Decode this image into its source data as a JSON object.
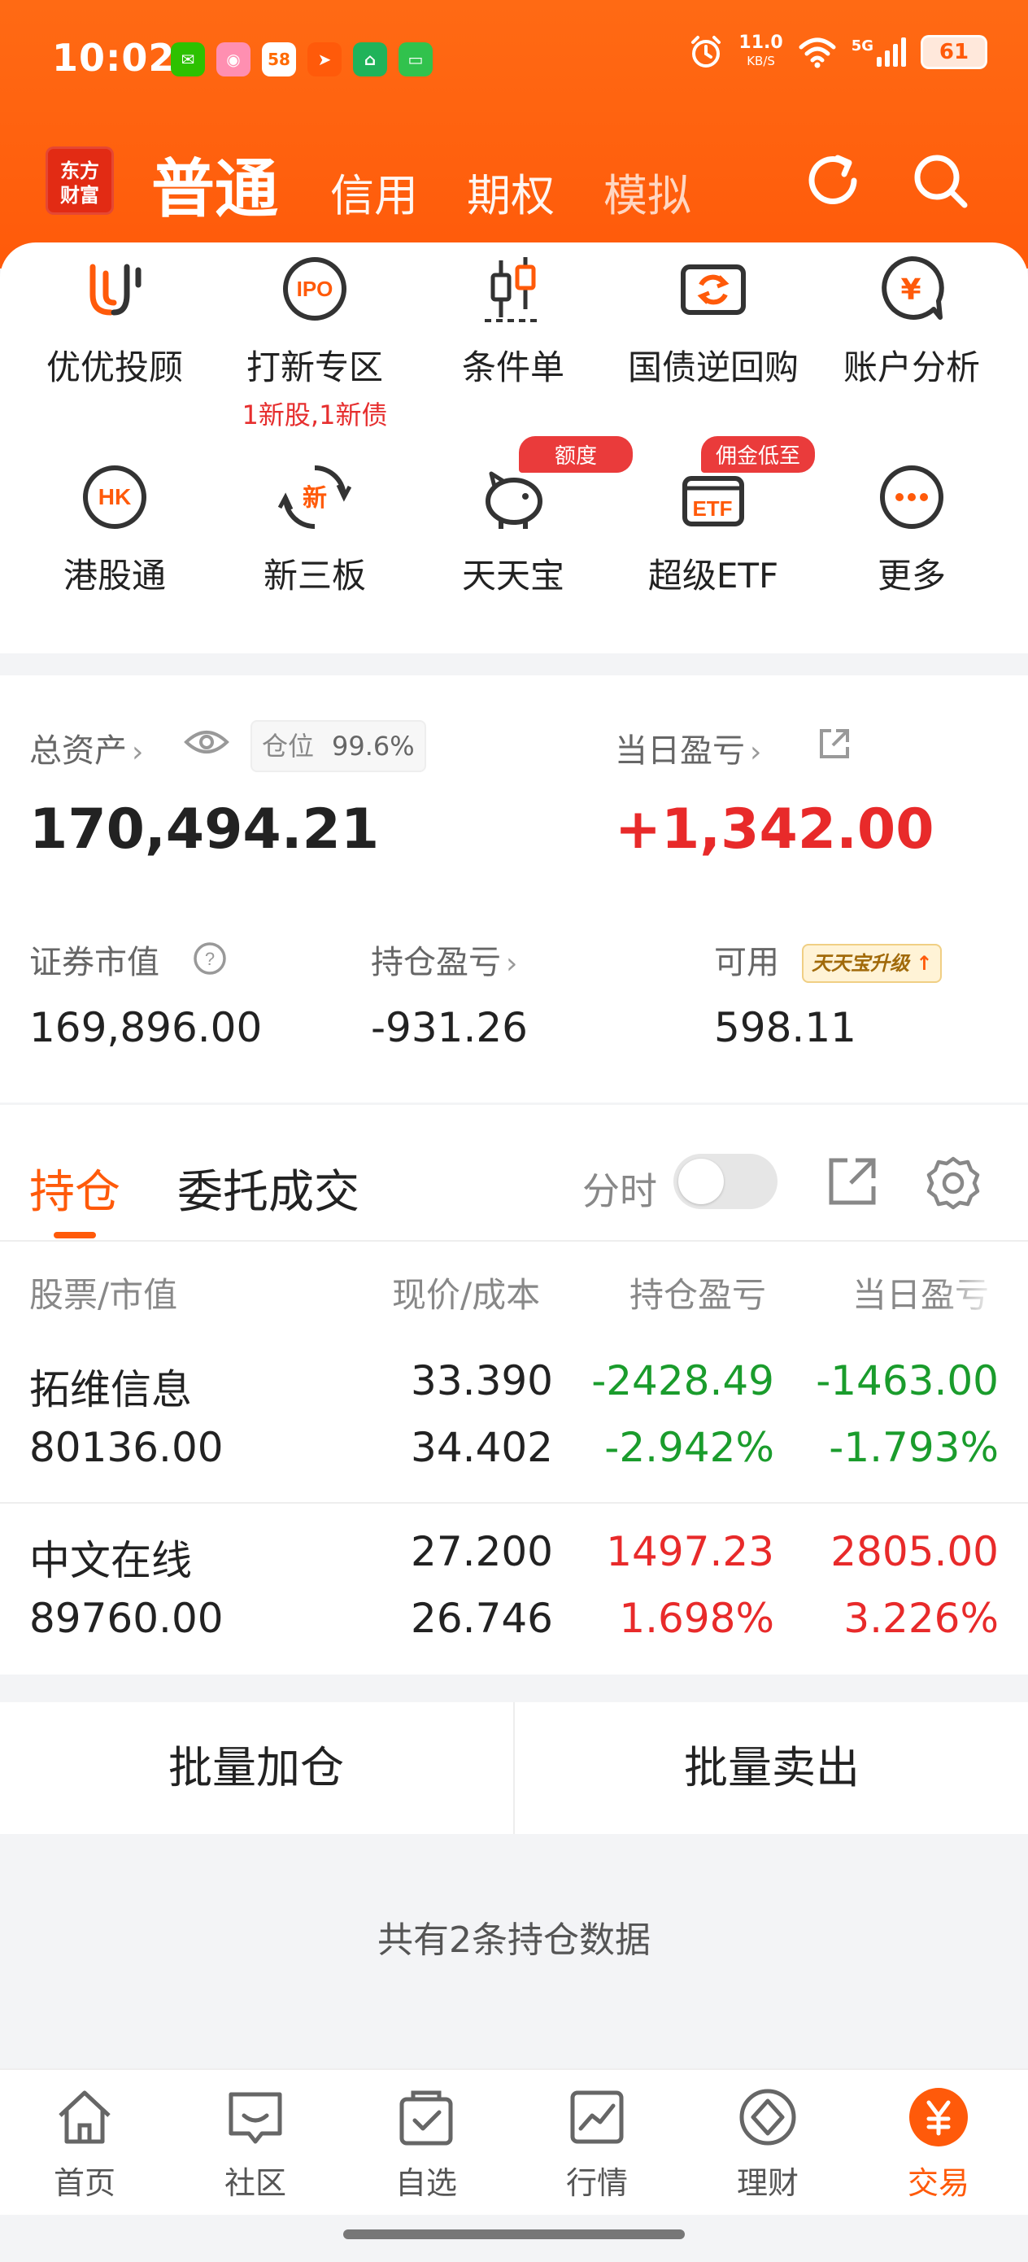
{
  "status_bar": {
    "time": "10:02",
    "net_speed": "11.0",
    "net_unit": "KB/S",
    "network": "5G",
    "battery": "61"
  },
  "notif_icons": [
    "wechat-icon",
    "bilibili-icon",
    "app58-icon",
    "paper-plane-icon",
    "home-app-icon",
    "message-icon"
  ],
  "header": {
    "logo_line1": "东方",
    "logo_line2": "财富",
    "tabs": [
      "普通",
      "信用",
      "期权",
      "模拟"
    ],
    "active_tab": "普通"
  },
  "features": [
    {
      "label": "优优投顾",
      "icon": "uu-advisor-icon"
    },
    {
      "label": "打新专区",
      "sub": "1新股,1新债",
      "icon": "ipo-icon"
    },
    {
      "label": "条件单",
      "icon": "candlestick-icon"
    },
    {
      "label": "国债逆回购",
      "icon": "bond-repo-icon"
    },
    {
      "label": "账户分析",
      "icon": "yen-chat-icon"
    },
    {
      "label": "港股通",
      "icon": "hk-icon"
    },
    {
      "label": "新三板",
      "icon": "new-board-icon"
    },
    {
      "label": "天天宝",
      "badge": "额度",
      "icon": "piggy-bank-icon"
    },
    {
      "label": "超级ETF",
      "badge": "佣金低至",
      "icon": "etf-icon"
    },
    {
      "label": "更多",
      "icon": "more-icon"
    }
  ],
  "assets": {
    "total_label": "总资产",
    "position_label": "仓位",
    "position_value": "99.6%",
    "total_value": "170,494.21",
    "daily_label": "当日盈亏",
    "daily_value": "+1,342.00",
    "market_value_label": "证券市值",
    "market_value": "169,896.00",
    "holding_pl_label": "持仓盈亏",
    "holding_pl": "-931.26",
    "available_label": "可用",
    "available_value": "598.11",
    "tiantianbao_chip": "天天宝升级"
  },
  "holdings": {
    "tabs": [
      "持仓",
      "委托成交"
    ],
    "fenshi_label": "分时",
    "columns": [
      "股票/市值",
      "现价/成本",
      "持仓盈亏",
      "当日盈亏"
    ],
    "rows": [
      {
        "name": "拓维信息",
        "market_value": "80136.00",
        "price": "33.390",
        "cost": "34.402",
        "pl": "-2428.49",
        "pl_pct": "-2.942%",
        "day_pl": "-1463.00",
        "day_pl_pct": "-1.793%",
        "color": "#1a9c2c"
      },
      {
        "name": "中文在线",
        "market_value": "89760.00",
        "price": "27.200",
        "cost": "26.746",
        "pl": "1497.23",
        "pl_pct": "1.698%",
        "day_pl": "2805.00",
        "day_pl_pct": "3.226%",
        "color": "#e82a2a"
      }
    ]
  },
  "batch": {
    "add_label": "批量加仓",
    "sell_label": "批量卖出"
  },
  "footnote": "共有2条持仓数据",
  "bottom_nav": [
    {
      "label": "首页",
      "icon": "home-icon"
    },
    {
      "label": "社区",
      "icon": "community-icon"
    },
    {
      "label": "自选",
      "icon": "watchlist-icon"
    },
    {
      "label": "行情",
      "icon": "market-icon"
    },
    {
      "label": "理财",
      "icon": "wealth-icon"
    },
    {
      "label": "交易",
      "icon": "trade-yen-icon",
      "active": true
    }
  ],
  "colors": {
    "brand_orange": "#ff5a0a",
    "gain_red": "#e82a2a",
    "loss_green": "#1a9c2c"
  }
}
